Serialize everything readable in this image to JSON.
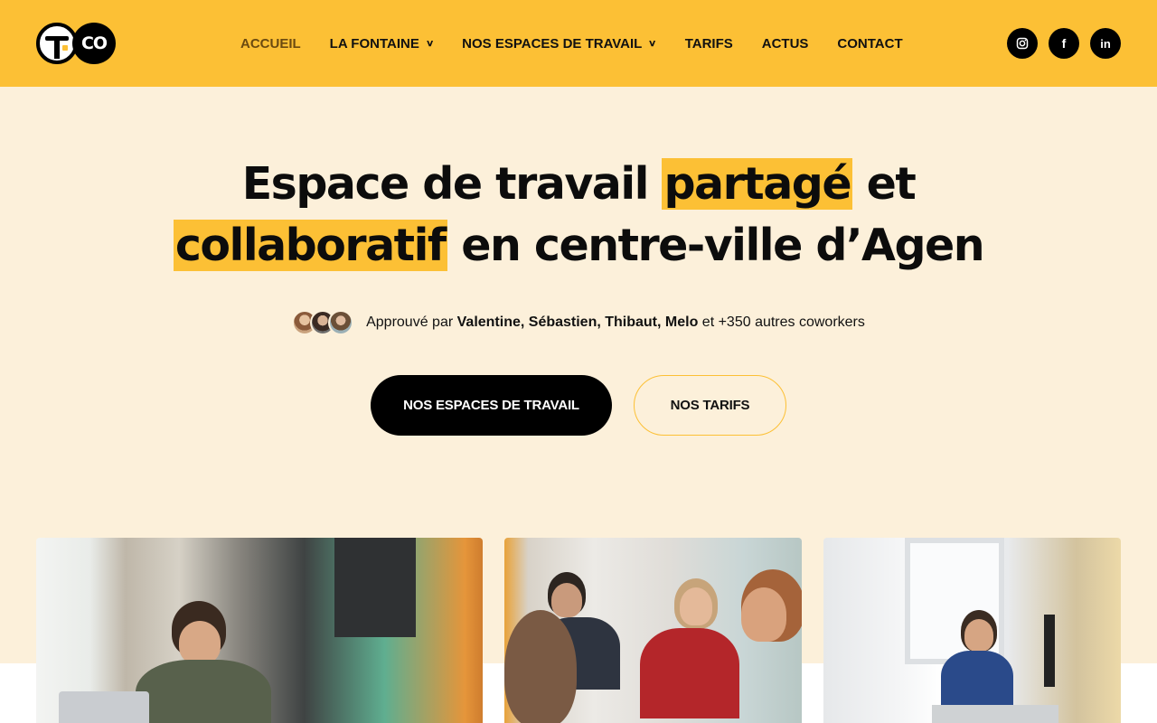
{
  "logo": {
    "text": "CO"
  },
  "nav": {
    "items": [
      {
        "label": "ACCUEIL",
        "active": true,
        "dropdown": false
      },
      {
        "label": "LA FONTAINE",
        "active": false,
        "dropdown": true
      },
      {
        "label": "NOS ESPACES DE TRAVAIL",
        "active": false,
        "dropdown": true
      },
      {
        "label": "TARIFS",
        "active": false,
        "dropdown": false
      },
      {
        "label": "ACTUS",
        "active": false,
        "dropdown": false
      },
      {
        "label": "CONTACT",
        "active": false,
        "dropdown": false
      }
    ]
  },
  "socials": [
    {
      "icon": "instagram-icon",
      "glyph": "◎"
    },
    {
      "icon": "facebook-icon",
      "glyph": "f"
    },
    {
      "icon": "linkedin-icon",
      "glyph": "in"
    }
  ],
  "hero": {
    "title_line1_a": "Espace de travail ",
    "title_line1_hl": "partagé",
    "title_line1_b": " et",
    "title_line2_hl": "collaboratif",
    "title_line2_b": " en centre-ville d’Agen",
    "approved_prefix": "Approuvé par ",
    "approved_names": "Valentine, Sébastien, Thibaut, Melo",
    "approved_suffix": " et +350 autres coworkers",
    "primary_button": "NOS ESPACES DE TRAVAIL",
    "secondary_button": "NOS TARIFS"
  },
  "colors": {
    "brand_yellow": "#fcc035",
    "hero_background": "#fcf0da",
    "primary_button": "#000000"
  }
}
